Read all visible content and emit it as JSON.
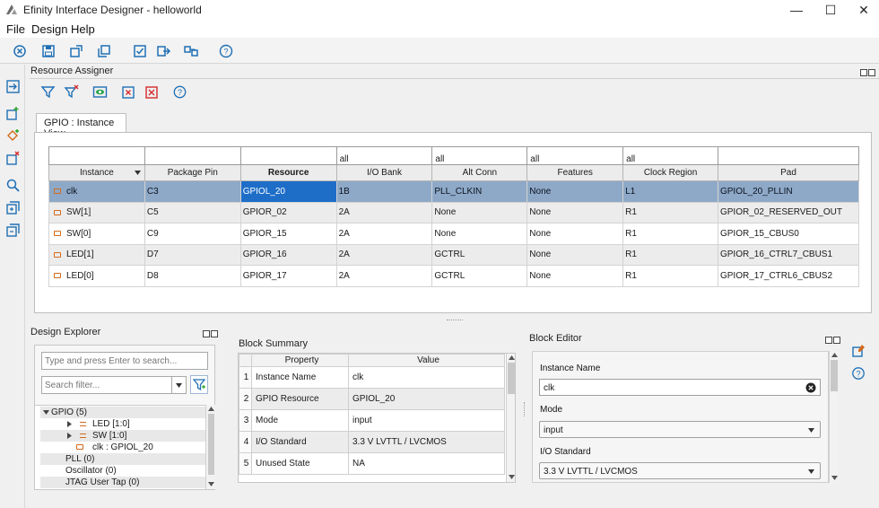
{
  "window": {
    "title": "Efinity Interface Designer - helloworld",
    "minimize": "—",
    "maximize": "☐",
    "close": "✕"
  },
  "menu": [
    "File",
    "Design",
    "Help"
  ],
  "resource_assigner": {
    "title": "Resource Assigner",
    "tab": "GPIO : Instance View",
    "filters": [
      "",
      "",
      "",
      "all",
      "all",
      "all",
      "all",
      ""
    ],
    "columns": [
      "Instance",
      "Package Pin",
      "Resource",
      "I/O Bank",
      "Alt Conn",
      "Features",
      "Clock Region",
      "Pad"
    ],
    "rows": [
      [
        "clk",
        "C3",
        "GPIOL_20",
        "1B",
        "PLL_CLKIN",
        "None",
        "L1",
        "GPIOL_20_PLLIN"
      ],
      [
        "SW[1]",
        "C5",
        "GPIOR_02",
        "2A",
        "None",
        "None",
        "R1",
        "GPIOR_02_RESERVED_OUT"
      ],
      [
        "SW[0]",
        "C9",
        "GPIOR_15",
        "2A",
        "None",
        "None",
        "R1",
        "GPIOR_15_CBUS0"
      ],
      [
        "LED[1]",
        "D7",
        "GPIOR_16",
        "2A",
        "GCTRL",
        "None",
        "R1",
        "GPIOR_16_CTRL7_CBUS1"
      ],
      [
        "LED[0]",
        "D8",
        "GPIOR_17",
        "2A",
        "GCTRL",
        "None",
        "R1",
        "GPIOR_17_CTRL6_CBUS2"
      ]
    ]
  },
  "design_explorer": {
    "title": "Design Explorer",
    "search_placeholder": "Type and press Enter to search...",
    "filter_placeholder": "Search filter...",
    "tree": {
      "gpio": "GPIO (5)",
      "led": "LED [1:0]",
      "sw": "SW [1:0]",
      "clk": "clk : GPIOL_20",
      "pll": "PLL (0)",
      "osc": "Oscillator (0)",
      "jtag": "JTAG User Tap (0)"
    }
  },
  "block_summary": {
    "title": "Block Summary",
    "headers": [
      "Property",
      "Value"
    ],
    "rows": [
      [
        "1",
        "Instance Name",
        "clk"
      ],
      [
        "2",
        "GPIO Resource",
        "GPIOL_20"
      ],
      [
        "3",
        "Mode",
        "input"
      ],
      [
        "4",
        "I/O Standard",
        "3.3 V LVTTL / LVCMOS"
      ],
      [
        "5",
        "Unused State",
        "NA"
      ]
    ]
  },
  "block_editor": {
    "title": "Block Editor",
    "instance_label": "Instance Name",
    "instance_value": "clk",
    "mode_label": "Mode",
    "mode_value": "input",
    "iostd_label": "I/O Standard",
    "iostd_value": "3.3 V LVTTL / LVCMOS"
  }
}
